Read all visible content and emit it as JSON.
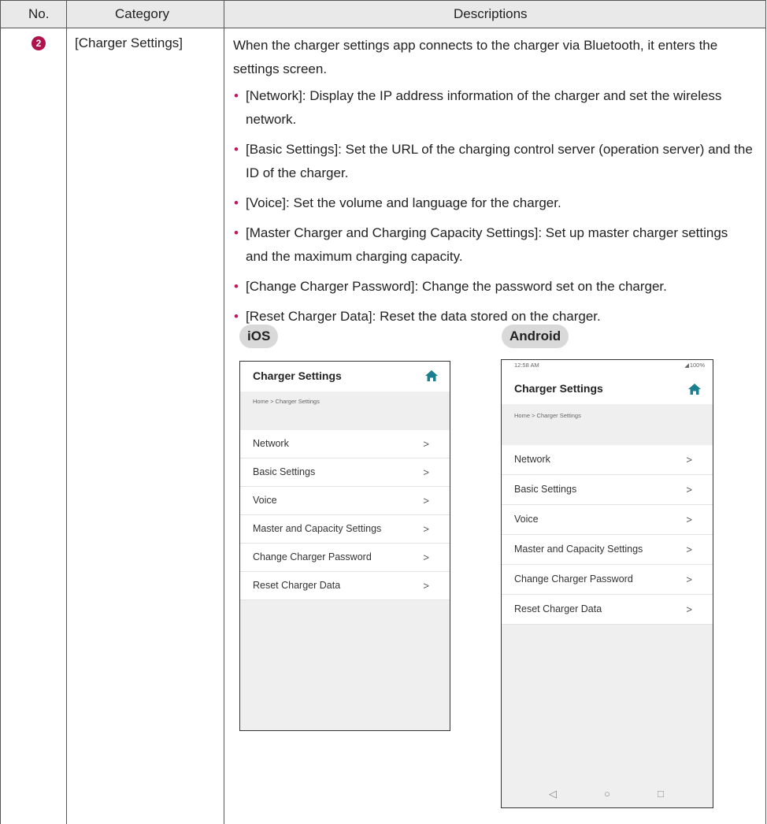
{
  "header": {
    "no": "No.",
    "category": "Category",
    "descriptions": "Descriptions"
  },
  "row": {
    "number": "2",
    "category": "[Charger Settings]",
    "intro": "When the charger settings app connects to the charger via Bluetooth, it enters the settings screen.",
    "bullets": [
      "[Network]: Display the IP address information of the charger and set the wireless network.",
      "[Basic Settings]: Set the URL of the charging control server (operation server) and the ID of the charger.",
      "[Voice]: Set the volume and language for the charger.",
      "[Master Charger and Charging Capacity Settings]: Set up master charger settings and the maximum charging capacity.",
      "[Change Charger Password]: Change the password set on the charger.",
      "[Reset Charger Data]: Reset the data stored on the charger."
    ]
  },
  "ios": {
    "tag": "iOS",
    "title": "Charger Settings",
    "breadcrumb": "Home > Charger Settings",
    "items": [
      "Network",
      "Basic Settings",
      "Voice",
      "Master and Capacity Settings",
      "Change Charger Password",
      "Reset Charger Data"
    ]
  },
  "android": {
    "tag": "Android",
    "time": "12:58 AM",
    "battery": "100%",
    "title": "Charger Settings",
    "breadcrumb": "Home > Charger Settings",
    "items": [
      "Network",
      "Basic Settings",
      "Voice",
      "Master and Capacity Settings",
      "Change Charger Password",
      "Reset Charger Data"
    ]
  },
  "colors": {
    "accent": "#c0185a",
    "home_icon": "#1a7f8e",
    "header_bg": "#e9e9e9"
  },
  "icons": {
    "home": "home-icon",
    "chevron": "chevron-right-icon",
    "back": "nav-back-icon",
    "home_nav": "nav-home-icon",
    "recents": "nav-recents-icon"
  }
}
